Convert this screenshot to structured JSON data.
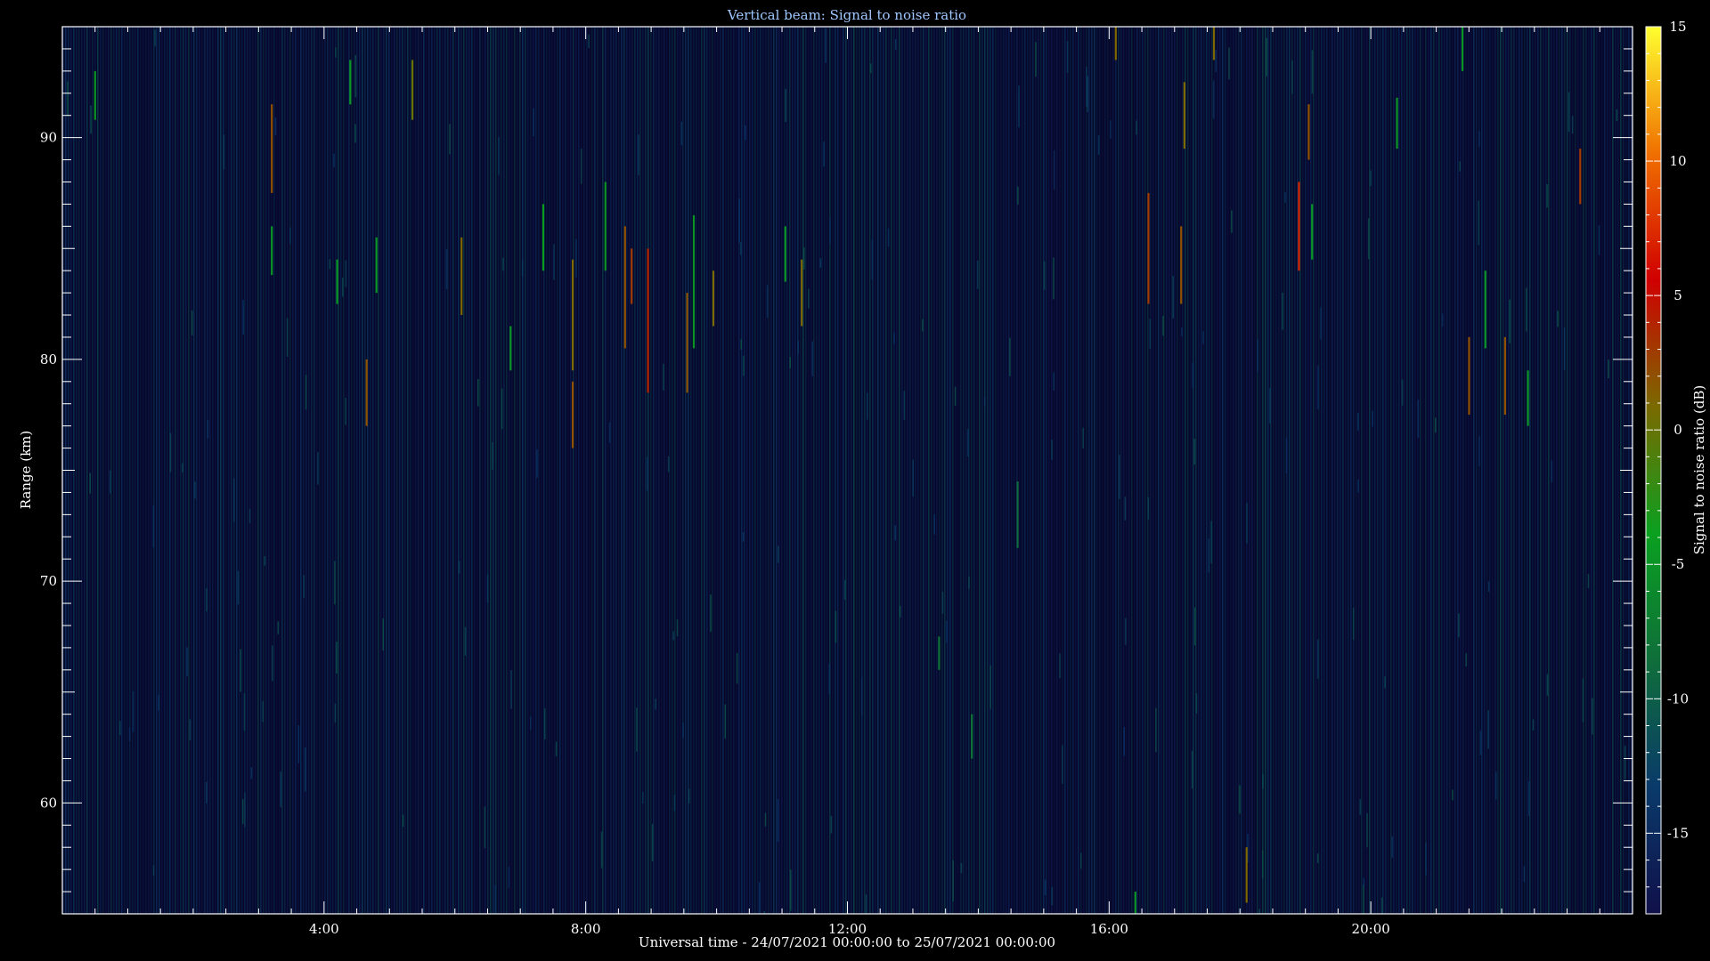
{
  "chart_data": {
    "type": "heatmap",
    "title": "Vertical beam: Signal to noise ratio",
    "xlabel": "Universal time - 24/07/2021 00:00:00 to 25/07/2021 00:00:00",
    "ylabel": "Range (km)",
    "xlim_hours": [
      0,
      24
    ],
    "ylim_km": [
      55,
      95
    ],
    "x_ticks": [
      {
        "hour": 4,
        "label": "4:00"
      },
      {
        "hour": 8,
        "label": "8:00"
      },
      {
        "hour": 12,
        "label": "12:00"
      },
      {
        "hour": 16,
        "label": "16:00"
      },
      {
        "hour": 20,
        "label": "20:00"
      }
    ],
    "y_ticks": [
      {
        "value": 60,
        "label": "60"
      },
      {
        "value": 70,
        "label": "70"
      },
      {
        "value": 80,
        "label": "80"
      },
      {
        "value": 90,
        "label": "90"
      }
    ],
    "colorbar": {
      "label": "Signal to noise ratio (dB)",
      "range": [
        -18,
        15
      ],
      "ticks": [
        {
          "value": 15,
          "label": "15"
        },
        {
          "value": 10,
          "label": "10"
        },
        {
          "value": 5,
          "label": "5"
        },
        {
          "value": 0,
          "label": "0"
        },
        {
          "value": -5,
          "label": "-5"
        },
        {
          "value": -10,
          "label": "-10"
        },
        {
          "value": -15,
          "label": "-15"
        }
      ],
      "colors": [
        "#10104a",
        "#0a3a6a",
        "#0f6e3a",
        "#0aa020",
        "#7a6a00",
        "#d00000",
        "#f07000",
        "#ffff30"
      ]
    },
    "background_snr_db": -17,
    "echoes": [
      {
        "t": 0.5,
        "r0": 90.8,
        "r1": 93,
        "snr": -5
      },
      {
        "t": 3.2,
        "r0": 87.5,
        "r1": 91.5,
        "snr": 2
      },
      {
        "t": 3.2,
        "r0": 83.8,
        "r1": 86,
        "snr": -5
      },
      {
        "t": 4.2,
        "r0": 82.5,
        "r1": 84.5,
        "snr": -5
      },
      {
        "t": 4.4,
        "r0": 91.5,
        "r1": 93.5,
        "snr": -5
      },
      {
        "t": 4.65,
        "r0": 77,
        "r1": 80,
        "snr": 2
      },
      {
        "t": 4.8,
        "r0": 83,
        "r1": 85.5,
        "snr": -5
      },
      {
        "t": 5.35,
        "r0": 90.8,
        "r1": 93.5,
        "snr": 0
      },
      {
        "t": 6.1,
        "r0": 82,
        "r1": 85.5,
        "snr": 1
      },
      {
        "t": 6.85,
        "r0": 79.5,
        "r1": 81.5,
        "snr": -5
      },
      {
        "t": 7.35,
        "r0": 84,
        "r1": 87,
        "snr": -4
      },
      {
        "t": 7.8,
        "r0": 76,
        "r1": 79,
        "snr": 2
      },
      {
        "t": 7.8,
        "r0": 79.5,
        "r1": 84.5,
        "snr": 1
      },
      {
        "t": 8.3,
        "r0": 84,
        "r1": 88,
        "snr": -5
      },
      {
        "t": 8.6,
        "r0": 80.5,
        "r1": 86,
        "snr": 2
      },
      {
        "t": 8.7,
        "r0": 82.5,
        "r1": 85,
        "snr": 3
      },
      {
        "t": 8.95,
        "r0": 78.5,
        "r1": 85,
        "snr": 4
      },
      {
        "t": 9.55,
        "r0": 78.5,
        "r1": 83,
        "snr": 2
      },
      {
        "t": 9.65,
        "r0": 80.5,
        "r1": 86.5,
        "snr": -5
      },
      {
        "t": 9.95,
        "r0": 81.5,
        "r1": 84,
        "snr": 1
      },
      {
        "t": 11.3,
        "r0": 81.5,
        "r1": 84.5,
        "snr": 1
      },
      {
        "t": 11.05,
        "r0": 83.5,
        "r1": 86,
        "snr": -5
      },
      {
        "t": 13.4,
        "r0": 66,
        "r1": 67.5,
        "snr": -8
      },
      {
        "t": 13.9,
        "r0": 62,
        "r1": 64,
        "snr": -8
      },
      {
        "t": 14.6,
        "r0": 71.5,
        "r1": 74.5,
        "snr": -9
      },
      {
        "t": 16.1,
        "r0": 93.5,
        "r1": 95,
        "snr": 1
      },
      {
        "t": 16.4,
        "r0": 55,
        "r1": 56,
        "snr": -5
      },
      {
        "t": 16.6,
        "r0": 82.5,
        "r1": 87.5,
        "snr": 3
      },
      {
        "t": 17.1,
        "r0": 82.5,
        "r1": 86,
        "snr": 2
      },
      {
        "t": 17.15,
        "r0": 89.5,
        "r1": 92.5,
        "snr": 1
      },
      {
        "t": 17.6,
        "r0": 93.5,
        "r1": 95,
        "snr": 1
      },
      {
        "t": 18.1,
        "r0": 55.5,
        "r1": 58,
        "snr": 1
      },
      {
        "t": 18.9,
        "r0": 84,
        "r1": 88,
        "snr": 7
      },
      {
        "t": 19.05,
        "r0": 89,
        "r1": 91.5,
        "snr": 2
      },
      {
        "t": 19.1,
        "r0": 84.5,
        "r1": 87,
        "snr": -5
      },
      {
        "t": 20.4,
        "r0": 89.5,
        "r1": 91.8,
        "snr": -5
      },
      {
        "t": 21.4,
        "r0": 93,
        "r1": 95,
        "snr": -5
      },
      {
        "t": 21.5,
        "r0": 77.5,
        "r1": 81,
        "snr": 2
      },
      {
        "t": 21.75,
        "r0": 80.5,
        "r1": 84,
        "snr": -5
      },
      {
        "t": 22.05,
        "r0": 77.5,
        "r1": 81,
        "snr": 2
      },
      {
        "t": 22.4,
        "r0": 77,
        "r1": 79.5,
        "snr": -5
      },
      {
        "t": 23.2,
        "r0": 87,
        "r1": 89.5,
        "snr": 3
      }
    ]
  }
}
